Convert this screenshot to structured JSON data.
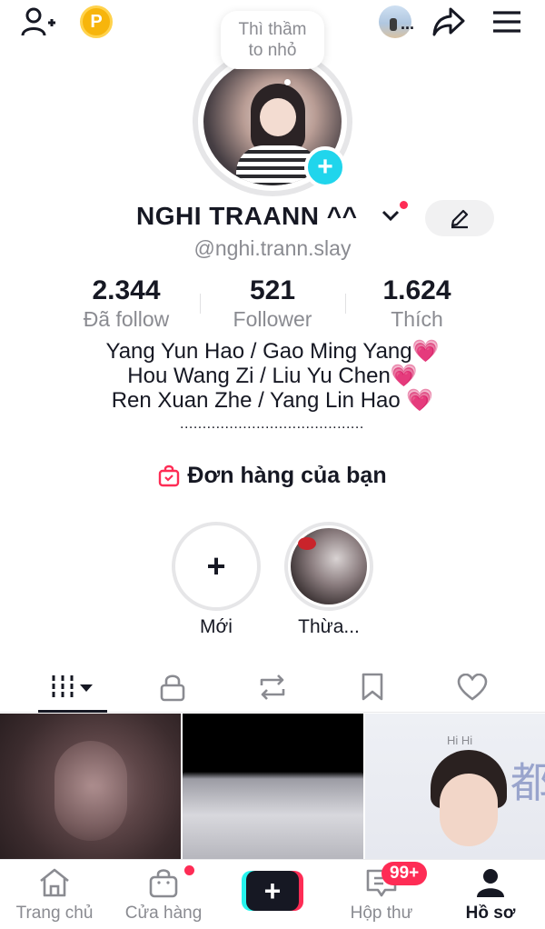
{
  "header": {
    "icons": [
      "add-friend-icon",
      "coin-icon",
      "mini-avatar",
      "share-icon",
      "menu-icon"
    ],
    "coin_label": "P",
    "avatar_ellipsis": "..."
  },
  "profile": {
    "note_bubble": "Thì thầm\nto nhỏ",
    "display_name": "NGHI TRAANN ^^",
    "username": "@nghi.trann.slay",
    "stats": [
      {
        "value": "2.344",
        "label": "Đã follow"
      },
      {
        "value": "521",
        "label": "Follower"
      },
      {
        "value": "1.624",
        "label": "Thích"
      }
    ],
    "bio": "Yang Yun Hao / Gao Ming Yang💗\nHou Wang Zi / Liu Yu Chen💗\nRen Xuan Zhe / Yang Lin Hao 💗",
    "bio_dots": "...................................................",
    "orders_label": "Đơn hàng của bạn"
  },
  "stories": [
    {
      "label": "Mới"
    },
    {
      "label": "Thừa..."
    }
  ],
  "tabs": [
    "videos-tab",
    "private-tab",
    "reposts-tab",
    "favorites-tab",
    "liked-tab"
  ],
  "colors": {
    "accent": "#fe2c55",
    "cyan": "#25f4ee",
    "plus_badge": "#20d5ec",
    "coin": "#f7b50c"
  },
  "grid_thumbs": {
    "third_overlay_text": "Hi Hi"
  },
  "bottom_nav": {
    "items": [
      {
        "label": "Trang chủ"
      },
      {
        "label": "Cửa hàng"
      },
      {
        "label": ""
      },
      {
        "label": "Hộp thư"
      },
      {
        "label": "Hồ sơ"
      }
    ],
    "inbox_badge": "99+",
    "create_label": "+"
  }
}
